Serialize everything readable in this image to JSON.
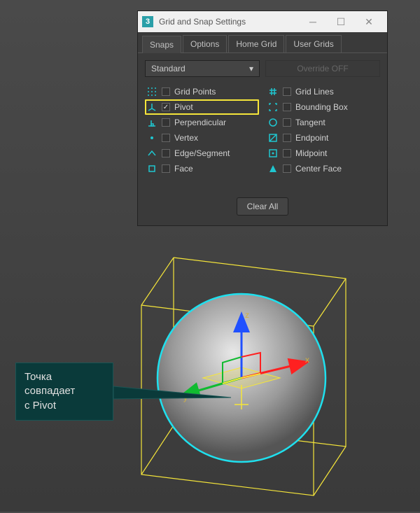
{
  "window": {
    "appIconLetter": "3",
    "title": "Grid and Snap Settings"
  },
  "tabs": {
    "t0": "Snaps",
    "t1": "Options",
    "t2": "Home Grid",
    "t3": "User Grids"
  },
  "dropdown": {
    "selected": "Standard"
  },
  "override": "Override OFF",
  "snapsLeft": {
    "gridPoints": "Grid Points",
    "pivot": "Pivot",
    "perpendicular": "Perpendicular",
    "vertex": "Vertex",
    "edgeSegment": "Edge/Segment",
    "face": "Face"
  },
  "snapsRight": {
    "gridLines": "Grid Lines",
    "boundingBox": "Bounding Box",
    "tangent": "Tangent",
    "endpoint": "Endpoint",
    "midpoint": "Midpoint",
    "centerFace": "Center Face"
  },
  "clearAll": "Clear All",
  "callout": {
    "line1": "Точка",
    "line2": "совпадает",
    "line3": "с Pivot"
  },
  "axisLabels": {
    "x": "x",
    "y": "y",
    "z": "z"
  }
}
